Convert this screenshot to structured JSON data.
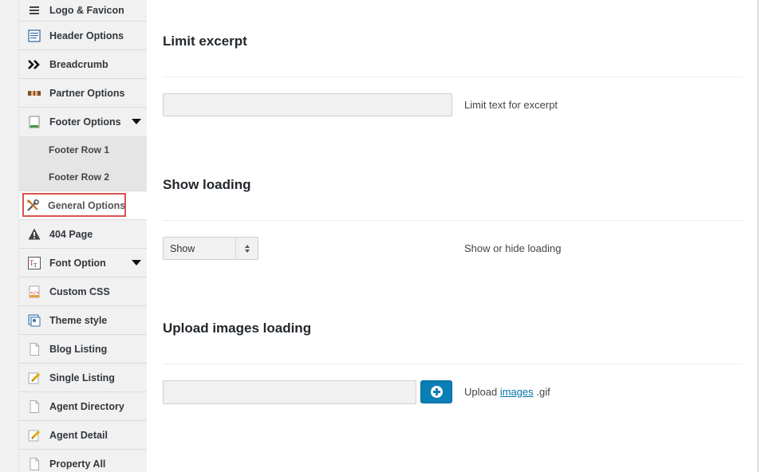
{
  "sidebar": {
    "items": [
      {
        "label": "Logo & Favicon",
        "icon": "hamburger-icon"
      },
      {
        "label": "Header Options",
        "icon": "document-icon"
      },
      {
        "label": "Breadcrumb",
        "icon": "double-chevron-icon"
      },
      {
        "label": "Partner Options",
        "icon": "partner-icon"
      },
      {
        "label": "Footer Options",
        "icon": "footer-icon",
        "expanded": true
      },
      {
        "label": "General Options",
        "icon": "tools-icon",
        "active": true
      },
      {
        "label": "404 Page",
        "icon": "warning-icon"
      },
      {
        "label": "Font Option",
        "icon": "font-icon"
      },
      {
        "label": "Custom CSS",
        "icon": "code-icon"
      },
      {
        "label": "Theme style",
        "icon": "theme-icon"
      },
      {
        "label": "Blog Listing",
        "icon": "page-icon"
      },
      {
        "label": "Single Listing",
        "icon": "edit-icon"
      },
      {
        "label": "Agent Directory",
        "icon": "page-icon"
      },
      {
        "label": "Agent Detail",
        "icon": "edit-icon"
      },
      {
        "label": "Property All",
        "icon": "page-icon"
      }
    ],
    "footer_sub": [
      "Footer Row 1",
      "Footer Row 2"
    ]
  },
  "main": {
    "limit_excerpt": {
      "title": "Limit excerpt",
      "value": "",
      "desc": "Limit text for excerpt"
    },
    "show_loading": {
      "title": "Show loading",
      "selected": "Show",
      "desc": "Show or hide loading"
    },
    "upload_loading": {
      "title": "Upload images loading",
      "value": "",
      "desc_prefix": "Upload",
      "desc_link": "images",
      "desc_suffix": ".gif"
    }
  },
  "colors": {
    "accent": "#0a7fb5",
    "highlight": "#d9534f",
    "sidebar_bg": "#f1f1f1"
  }
}
